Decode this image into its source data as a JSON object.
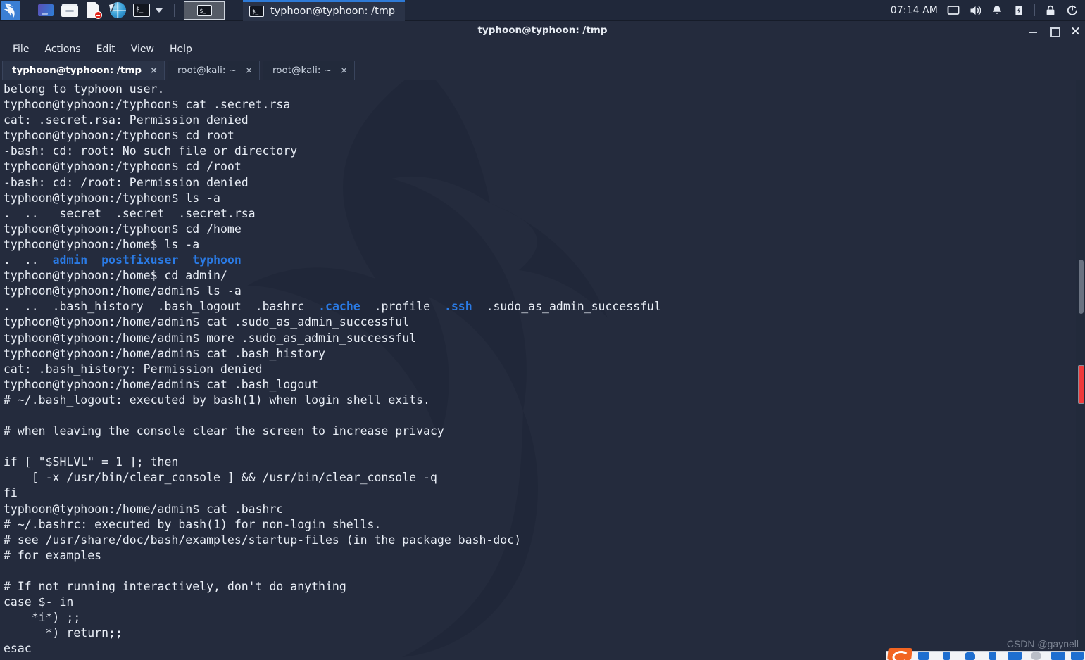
{
  "panel": {
    "logo_name": "kali-dragon-logo",
    "launchers": [
      {
        "name": "applications-menu-icon",
        "label": "Applications"
      },
      {
        "name": "file-manager-icon",
        "label": "File Manager"
      },
      {
        "name": "text-editor-icon",
        "label": "Text Editor"
      },
      {
        "name": "web-browser-icon",
        "label": "Web Browser"
      },
      {
        "name": "terminal-icon",
        "label": "Terminal"
      }
    ],
    "dropdown_icon": "chevron-down-icon",
    "window_button_icon": "terminal-icon",
    "task": {
      "icon": "terminal-icon",
      "label": "typhoon@typhoon: /tmp",
      "active_accent": "#2e7ad6"
    },
    "tray": {
      "clock": "07:14 AM",
      "icons": [
        {
          "name": "display-icon"
        },
        {
          "name": "volume-icon"
        },
        {
          "name": "notification-bell-icon"
        },
        {
          "name": "battery-icon"
        },
        {
          "name": "lock-icon"
        },
        {
          "name": "power-logout-icon"
        }
      ]
    }
  },
  "window": {
    "title": "typhoon@typhoon: /tmp",
    "controls": [
      {
        "name": "minimize-button",
        "glyph": "minimize"
      },
      {
        "name": "maximize-button",
        "glyph": "maximize"
      },
      {
        "name": "close-button",
        "glyph": "close"
      }
    ],
    "menus": [
      "File",
      "Actions",
      "Edit",
      "View",
      "Help"
    ],
    "tabs": [
      {
        "label": "typhoon@typhoon: /tmp",
        "active": true,
        "close": "×"
      },
      {
        "label": "root@kali: ~",
        "active": false,
        "close": "×"
      },
      {
        "label": "root@kali: ~",
        "active": false,
        "close": "×"
      }
    ]
  },
  "terminal": {
    "foreground": "#e9eef6",
    "background": "#242b3d",
    "dir_color": "#2a7ae4",
    "lines": [
      "belong to typhoon user.",
      "typhoon@typhoon:/typhoon$ cat .secret.rsa",
      "cat: .secret.rsa: Permission denied",
      "typhoon@typhoon:/typhoon$ cd root",
      "-bash: cd: root: No such file or directory",
      "typhoon@typhoon:/typhoon$ cd /root",
      "-bash: cd: /root: Permission denied",
      "typhoon@typhoon:/typhoon$ ls -a",
      ".  ..   secret  .secret  .secret.rsa",
      "typhoon@typhoon:/typhoon$ cd /home",
      "typhoon@typhoon:/home$ ls -a",
      ".  ..  admin  postfixuser  typhoon",
      "typhoon@typhoon:/home$ cd admin/",
      "typhoon@typhoon:/home/admin$ ls -a",
      ".  ..  .bash_history  .bash_logout  .bashrc  .cache  .profile  .ssh  .sudo_as_admin_successful",
      "typhoon@typhoon:/home/admin$ cat .sudo_as_admin_successful",
      "typhoon@typhoon:/home/admin$ more .sudo_as_admin_successful",
      "typhoon@typhoon:/home/admin$ cat .bash_history",
      "cat: .bash_history: Permission denied",
      "typhoon@typhoon:/home/admin$ cat .bash_logout",
      "# ~/.bash_logout: executed by bash(1) when login shell exits.",
      "",
      "# when leaving the console clear the screen to increase privacy",
      "",
      "if [ \"$SHLVL\" = 1 ]; then",
      "    [ -x /usr/bin/clear_console ] && /usr/bin/clear_console -q",
      "fi",
      "typhoon@typhoon:/home/admin$ cat .bashrc",
      "# ~/.bashrc: executed by bash(1) for non-login shells.",
      "# see /usr/share/doc/bash/examples/startup-files (in the package bash-doc)",
      "# for examples",
      "",
      "# If not running interactively, don't do anything",
      "case $- in",
      "    *i*) ;;",
      "      *) return;;",
      "esac"
    ],
    "colored_segments": {
      "line_11_dirs": [
        "admin",
        "postfixuser",
        "typhoon"
      ],
      "line_14_dirs": [
        ".cache",
        ".ssh"
      ]
    }
  },
  "watermark": "CSDN @gaynell"
}
